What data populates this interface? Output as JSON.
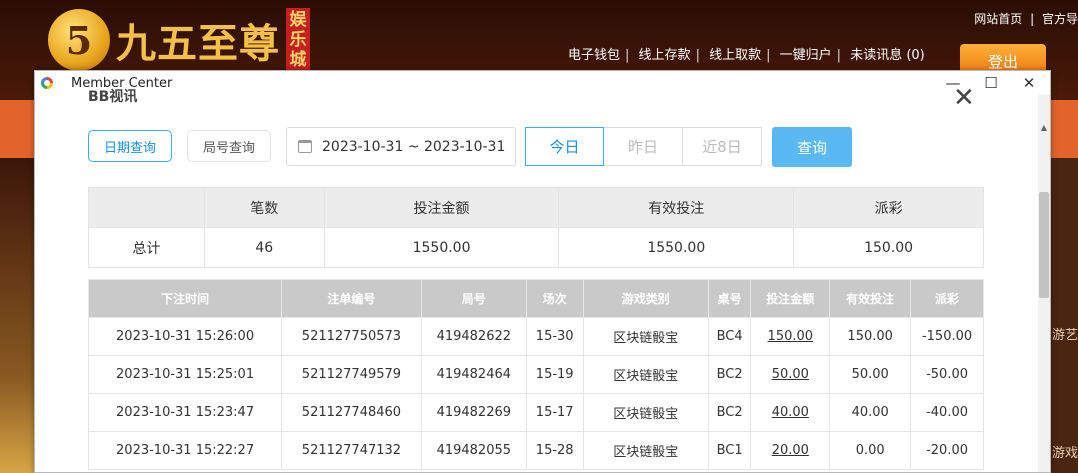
{
  "site": {
    "logo_glyph": "5",
    "logo_text": "九五至尊",
    "logo_sub": [
      "娱",
      "乐",
      "城"
    ],
    "top_links": [
      "网站首页",
      "|",
      "官方导"
    ],
    "nav": [
      "电子钱包",
      "线上存款",
      "线上取款",
      "一键归户",
      "未读讯息 (0)"
    ],
    "login_label": "登出",
    "side_labels": [
      "游艺",
      "游戏"
    ]
  },
  "window": {
    "title": "Member Center",
    "minimize": "—",
    "maximize": "☐",
    "close": "✕"
  },
  "panel": {
    "title": "BB视讯",
    "close": "✕"
  },
  "filters": {
    "date_query": "日期查询",
    "round_query": "局号查询",
    "date_range": "2023-10-31 ~ 2023-10-31",
    "today": "今日",
    "yesterday": "昨日",
    "last8": "近8日",
    "query": "查询"
  },
  "summary": {
    "headers": [
      "",
      "笔数",
      "投注金额",
      "有效投注",
      "派彩"
    ],
    "row": [
      "总计",
      "46",
      "1550.00",
      "1550.00",
      "150.00"
    ]
  },
  "details": {
    "headers": [
      "下注时间",
      "注单编号",
      "局号",
      "场次",
      "游戏类别",
      "桌号",
      "投注金额",
      "有效投注",
      "派彩"
    ],
    "rows": [
      [
        "2023-10-31 15:26:00",
        "521127750573",
        "419482622",
        "15-30",
        "区块链骰宝",
        "BC4",
        "150.00",
        "150.00",
        "-150.00"
      ],
      [
        "2023-10-31 15:25:01",
        "521127749579",
        "419482464",
        "15-19",
        "区块链骰宝",
        "BC2",
        "50.00",
        "50.00",
        "-50.00"
      ],
      [
        "2023-10-31 15:23:47",
        "521127748460",
        "419482269",
        "15-17",
        "区块链骰宝",
        "BC2",
        "40.00",
        "40.00",
        "-40.00"
      ],
      [
        "2023-10-31 15:22:27",
        "521127747132",
        "419482055",
        "15-28",
        "区块链骰宝",
        "BC1",
        "20.00",
        "0.00",
        "-20.00"
      ]
    ]
  }
}
